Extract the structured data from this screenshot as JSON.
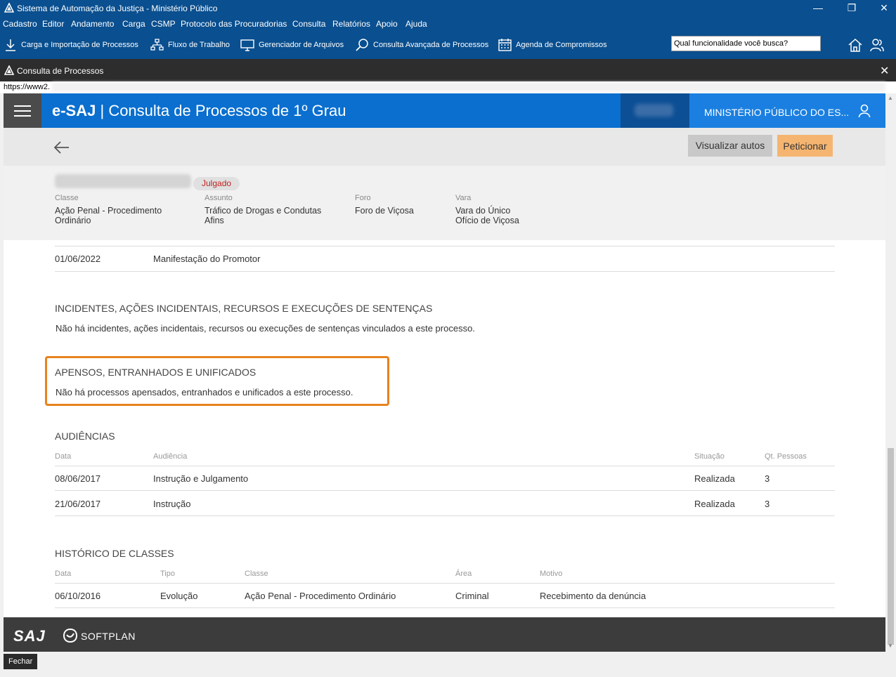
{
  "window": {
    "title": "Sistema de Automação da Justiça - Ministério Público",
    "minimize": "—",
    "restore": "❐",
    "close": "✕"
  },
  "menu": [
    "Cadastro",
    "Editor",
    "Andamento",
    "Carga",
    "CSMP",
    "Protocolo das Procuradorias",
    "Consulta",
    "Relatórios",
    "Apoio",
    "Ajuda"
  ],
  "toolbar": {
    "items": [
      "Carga e Importação de Processos",
      "Fluxo de Trabalho",
      "Gerenciador de Arquivos",
      "Consulta Avançada de Processos",
      "Agenda de Compromissos"
    ],
    "search_placeholder": "Qual funcionalidade você busca?"
  },
  "subwindow": {
    "title": "Consulta de Processos",
    "close": "✕"
  },
  "url": "https://www2.",
  "esaj": {
    "brand": "e-SAJ",
    "page_title": "Consulta de Processos de 1º Grau",
    "user": "MINISTÉRIO PÚBLICO DO ES..."
  },
  "actions": {
    "view_records": "Visualizar autos",
    "petition": "Peticionar"
  },
  "process": {
    "status": "Julgado",
    "fields": [
      {
        "label": "Classe",
        "value": [
          "Ação Penal - Procedimento",
          "Ordinário"
        ]
      },
      {
        "label": "Assunto",
        "value": [
          "Tráfico de Drogas e Condutas",
          "Afins"
        ]
      },
      {
        "label": "Foro",
        "value": [
          "Foro de Viçosa",
          ""
        ]
      },
      {
        "label": "Vara",
        "value": [
          "Vara do Único",
          "Ofício de Viçosa"
        ]
      }
    ]
  },
  "movement": {
    "date": "01/06/2022",
    "description": "Manifestação do Promotor"
  },
  "incidents": {
    "title": "INCIDENTES, AÇÕES INCIDENTAIS, RECURSOS E EXECUÇÕES DE SENTENÇAS",
    "text": "Não há incidentes, ações incidentais, recursos ou execuções de sentenças vinculados a este processo."
  },
  "attached": {
    "title": "APENSOS, ENTRANHADOS E UNIFICADOS",
    "text": "Não há processos apensados, entranhados e unificados a este processo.",
    "highlight_color": "#e8821e"
  },
  "hearings": {
    "title": "AUDIÊNCIAS",
    "headers": [
      "Data",
      "Audiência",
      "Situação",
      "Qt. Pessoas"
    ],
    "rows": [
      [
        "08/06/2017",
        "Instrução e Julgamento",
        "Realizada",
        "3"
      ],
      [
        "21/06/2017",
        "Instrução",
        "Realizada",
        "3"
      ]
    ]
  },
  "class_history": {
    "title": "HISTÓRICO DE CLASSES",
    "headers": [
      "Data",
      "Tipo",
      "Classe",
      "Área",
      "Motivo"
    ],
    "rows": [
      [
        "06/10/2016",
        "Evolução",
        "Ação Penal - Procedimento Ordinário",
        "Criminal",
        "Recebimento da denúncia"
      ]
    ]
  },
  "footer": {
    "saj_logo": "SAJ",
    "softplan_logo": "SOFTPLAN"
  },
  "status": {
    "close_button": "Fechar"
  }
}
